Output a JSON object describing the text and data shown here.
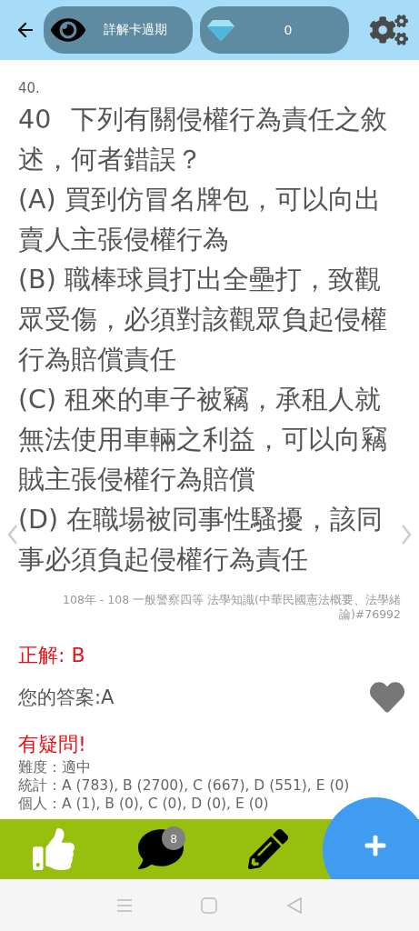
{
  "header": {
    "explanation_button": "詳解卡過期",
    "diamonds": "0"
  },
  "question": {
    "index": "40.",
    "number": "40",
    "text": "下列有關侵權行為責任之敘述，何者錯誤？",
    "options": [
      "(A) 買到仿冒名牌包，可以向出賣人主張侵權行為",
      "(B) 職棒球員打出全壘打，致觀眾受傷，必須對該觀眾負起侵權行為賠償責任",
      "(C) 租來的車子被竊，承租人就無法使用車輛之利益，可以向竊賊主張侵權行為賠償",
      "(D) 在職場被同事性騷擾，該同事必須負起侵權行為責任"
    ],
    "source": "108年 - 108 一般警察四等 法學知識(中華民國憲法概要、法學緒論)#76992"
  },
  "answer": {
    "correct": "正解: B",
    "yours": "您的答案:A",
    "doubt": "有疑問!",
    "stats": [
      "難度：適中",
      "統計：A (783), B (2700), C (667), D (551), E (0)",
      "個人：A (1), B (0), C (0), D (0), E (0)"
    ]
  },
  "toolbar": {
    "comment_count": "8"
  }
}
